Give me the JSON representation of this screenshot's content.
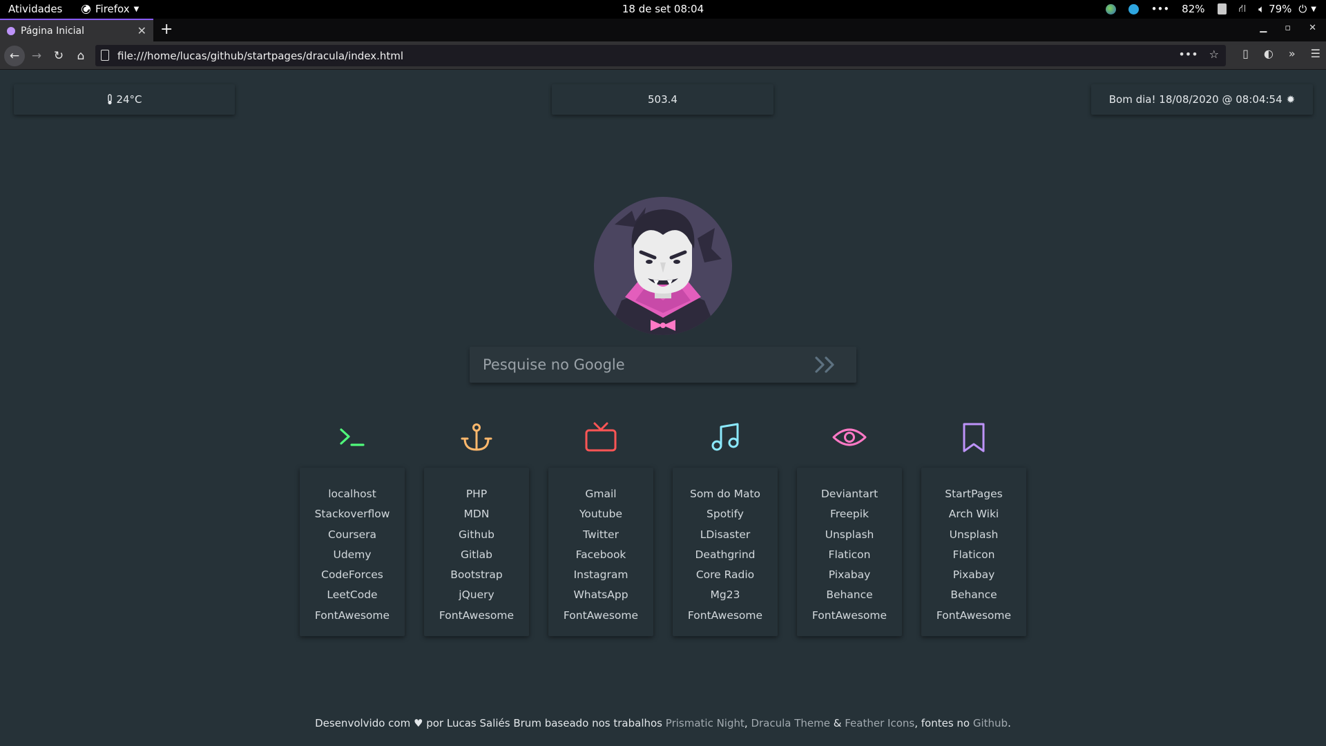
{
  "gnome_bar": {
    "activities": "Atividades",
    "app_name": "Firefox",
    "clock": "18 de set  08:04",
    "brightness": "82%",
    "volume": "79%"
  },
  "browser": {
    "tab_title": "Página Inicial",
    "url": "file:///home/lucas/github/startpages/dracula/index.html"
  },
  "widgets": {
    "weather": "24°C",
    "counter": "503.4",
    "greeting": "Bom dia! 18/08/2020 @ 08:04:54"
  },
  "search": {
    "placeholder": "Pesquise no Google"
  },
  "columns": [
    {
      "icon": "terminal-icon",
      "color": "#50fa7b",
      "links": [
        "localhost",
        "Stackoverflow",
        "Coursera",
        "Udemy",
        "CodeForces",
        "LeetCode",
        "FontAwesome"
      ]
    },
    {
      "icon": "anchor-icon",
      "color": "#ffb86c",
      "links": [
        "PHP",
        "MDN",
        "Github",
        "Gitlab",
        "Bootstrap",
        "jQuery",
        "FontAwesome"
      ]
    },
    {
      "icon": "tv-icon",
      "color": "#ff5555",
      "links": [
        "Gmail",
        "Youtube",
        "Twitter",
        "Facebook",
        "Instagram",
        "WhatsApp",
        "FontAwesome"
      ]
    },
    {
      "icon": "music-icon",
      "color": "#8be9fd",
      "links": [
        "Som do Mato",
        "Spotify",
        "LDisaster",
        "Deathgrind",
        "Core Radio",
        "Mg23",
        "FontAwesome"
      ]
    },
    {
      "icon": "eye-icon",
      "color": "#ff79c6",
      "links": [
        "Deviantart",
        "Freepik",
        "Unsplash",
        "Flaticon",
        "Pixabay",
        "Behance",
        "FontAwesome"
      ]
    },
    {
      "icon": "bookmark-icon",
      "color": "#bd93f9",
      "links": [
        "StartPages",
        "Arch Wiki",
        "Unsplash",
        "Flaticon",
        "Pixabay",
        "Behance",
        "FontAwesome"
      ]
    }
  ],
  "footer": {
    "t1": "Desenvolvido com",
    "t2": "por Lucas Saliés Brum baseado nos trabalhos",
    "l1": "Prismatic Night",
    "sep1": ",",
    "l2": "Dracula Theme",
    "amp": "&",
    "l3": "Feather Icons",
    "t3": ", fontes no",
    "l4": "Github",
    "dot": "."
  }
}
